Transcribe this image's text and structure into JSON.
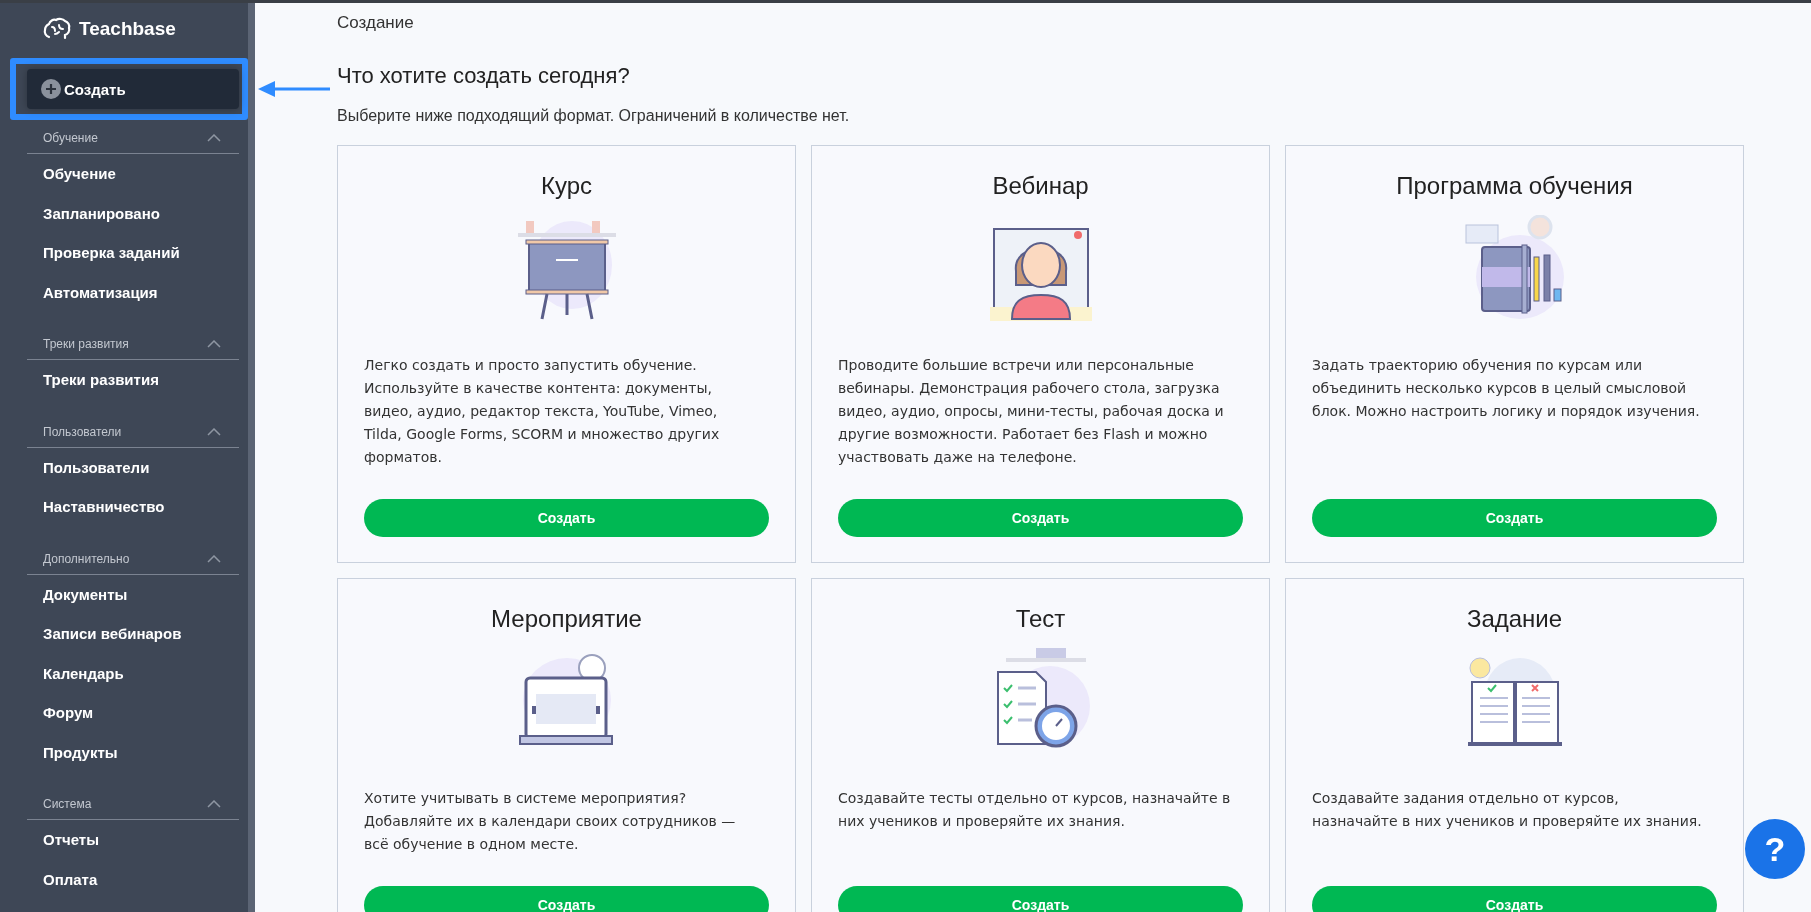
{
  "sidebar": {
    "logo": "Teachbase",
    "create_button": {
      "label": "Создать",
      "highlighted": true
    },
    "sections": [
      {
        "title": "Обучение",
        "expanded": true,
        "items": [
          "Обучение",
          "Запланировано",
          "Проверка заданий",
          "Автоматизация"
        ]
      },
      {
        "title": "Треки развития",
        "expanded": true,
        "items": [
          "Треки развития"
        ]
      },
      {
        "title": "Пользователи",
        "expanded": true,
        "items": [
          "Пользователи",
          "Наставничество"
        ]
      },
      {
        "title": "Дополнительно",
        "expanded": true,
        "items": [
          "Документы",
          "Записи вебинаров",
          "Календарь",
          "Форум",
          "Продукты"
        ]
      },
      {
        "title": "Система",
        "expanded": true,
        "items": [
          "Отчеты",
          "Оплата"
        ]
      }
    ]
  },
  "breadcrumb": "Создание",
  "heading": "Что хотите создать сегодня?",
  "subtitle": "Выберите ниже подходящий формат. Ограничений в количестве нет.",
  "cards": [
    {
      "kind": "course",
      "title": "Курс",
      "description": "Легко создать и просто запустить обучение. Используйте в качестве контента: документы, видео, аудио, редактор текста, YouTube, Vimeo, Tilda, Google Forms, SCORM и множество других форматов.",
      "button": "Создать"
    },
    {
      "kind": "webinar",
      "title": "Вебинар",
      "description": "Проводите большие встречи или персональные вебинары. Демонстрация рабочего стола, загрузка видео, аудио, опросы, мини-тесты, рабочая доска и другие возможности. Работает без Flash и можно участвовать даже на телефоне.",
      "button": "Создать"
    },
    {
      "kind": "program",
      "title": "Программа обучения",
      "description": "Задать траекторию обучения по курсам или объединить несколько курсов в целый смысловой блок. Можно настроить логику и порядок изучения.",
      "button": "Создать"
    },
    {
      "kind": "event",
      "title": "Мероприятие",
      "description": "Хотите учитывать в системе мероприятия? Добавляйте их в календари своих сотрудников — всё обучение в одном месте.",
      "button": "Создать"
    },
    {
      "kind": "test",
      "title": "Тест",
      "description": "Создавайте тесты отдельно от курсов, назначайте в них учеников и проверяйте их знания.",
      "button": "Создать"
    },
    {
      "kind": "task",
      "title": "Задание",
      "description": "Создавайте задания отдельно от курсов, назначайте в них учеников и проверяйте их знания.",
      "button": "Создать"
    }
  ],
  "help_button": "?"
}
